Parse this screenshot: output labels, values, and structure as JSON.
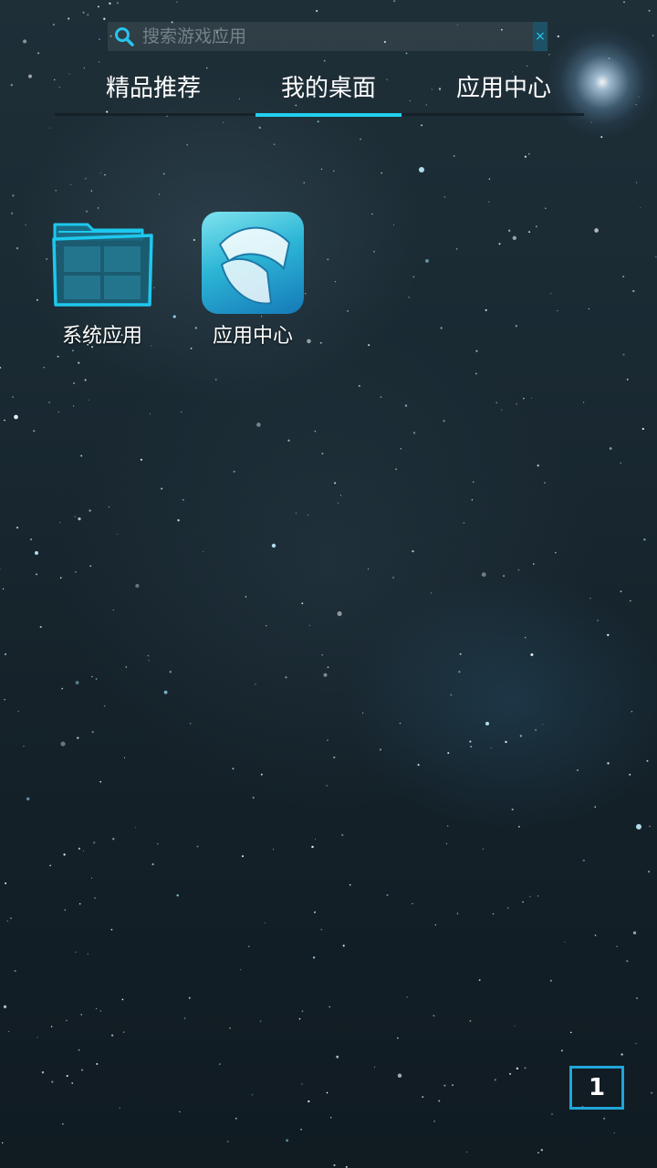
{
  "search": {
    "placeholder": "搜索游戏应用",
    "clear_label": "×"
  },
  "tabs": [
    {
      "label": "精品推荐",
      "selected": false
    },
    {
      "label": "我的桌面",
      "selected": true
    },
    {
      "label": "应用中心",
      "selected": false
    }
  ],
  "desktop": {
    "apps": [
      {
        "label": "系统应用",
        "icon": "folder-icon"
      },
      {
        "label": "应用中心",
        "icon": "app-center-icon"
      }
    ]
  },
  "page_indicator": {
    "current": "1"
  },
  "colors": {
    "accent": "#21d1ee",
    "folder_stroke": "#1ec8ee",
    "page_border": "#1fa6d8"
  }
}
